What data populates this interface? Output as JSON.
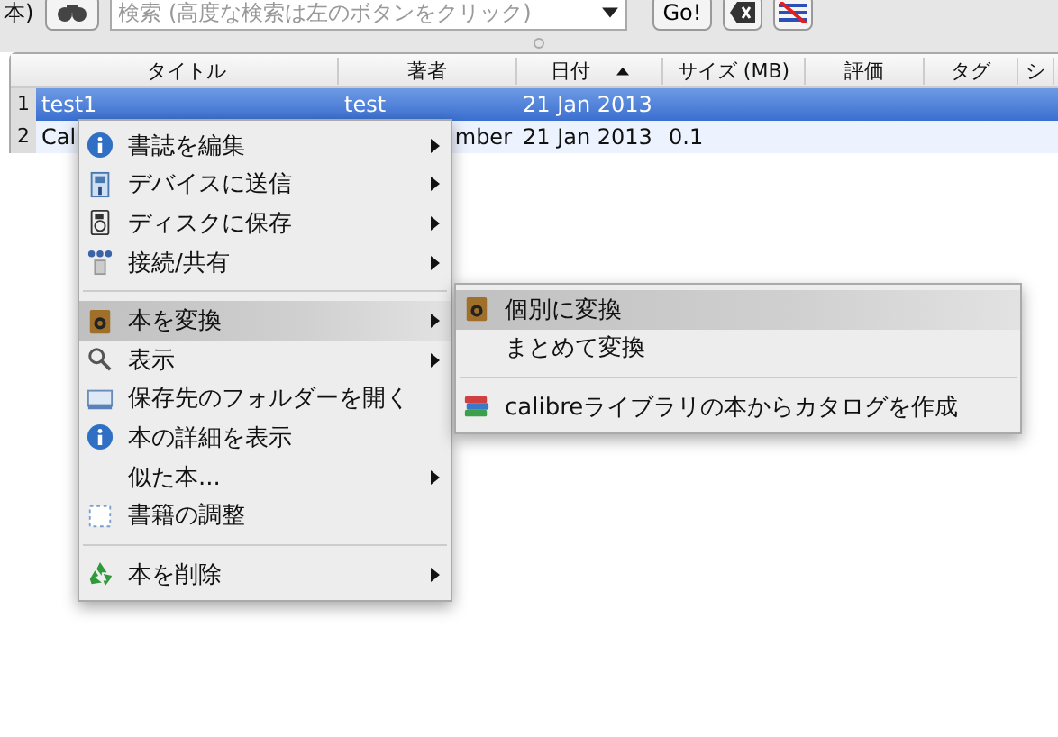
{
  "toolbar": {
    "left_label": "本)",
    "search": {
      "placeholder": "検索 (高度な検索は左のボタンをクリック)"
    },
    "go_button": "Go!"
  },
  "table": {
    "columns": [
      {
        "label": "タイトル",
        "sorted": false
      },
      {
        "label": "著者",
        "sorted": false
      },
      {
        "label": "日付",
        "sorted": true
      },
      {
        "label": "サイズ (MB)",
        "sorted": false
      },
      {
        "label": "評価",
        "sorted": false
      },
      {
        "label": "タグ",
        "sorted": false
      },
      {
        "label": "シ",
        "sorted": false
      }
    ],
    "rows": [
      {
        "number": "1",
        "selected": true,
        "cells": [
          "test1",
          "test",
          "21 Jan 2013",
          "",
          "",
          "",
          ""
        ]
      },
      {
        "number": "2",
        "selected": false,
        "cells": [
          "Cal",
          "mber",
          "21 Jan 2013",
          "0.1",
          "",
          "",
          ""
        ]
      }
    ]
  },
  "context_menu": {
    "items": [
      {
        "kind": "item",
        "label": "書誌を編集",
        "has_submenu": true,
        "selected": false
      },
      {
        "kind": "item",
        "label": "デバイスに送信",
        "has_submenu": true,
        "selected": false
      },
      {
        "kind": "item",
        "label": "ディスクに保存",
        "has_submenu": true,
        "selected": false
      },
      {
        "kind": "item",
        "label": "接続/共有",
        "has_submenu": true,
        "selected": false
      },
      {
        "kind": "separator"
      },
      {
        "kind": "item",
        "label": "本を変換",
        "has_submenu": true,
        "selected": true
      },
      {
        "kind": "item",
        "label": "表示",
        "has_submenu": true,
        "selected": false
      },
      {
        "kind": "item",
        "label": "保存先のフォルダーを開く",
        "has_submenu": false,
        "selected": false
      },
      {
        "kind": "item",
        "label": "本の詳細を表示",
        "has_submenu": false,
        "selected": false
      },
      {
        "kind": "item",
        "label": "似た本...",
        "has_submenu": true,
        "selected": false
      },
      {
        "kind": "item",
        "label": "書籍の調整",
        "has_submenu": false,
        "selected": false
      },
      {
        "kind": "separator"
      },
      {
        "kind": "item",
        "label": "本を削除",
        "has_submenu": true,
        "selected": false
      }
    ]
  },
  "submenu": {
    "items": [
      {
        "kind": "item",
        "label": "個別に変換",
        "selected": true
      },
      {
        "kind": "item",
        "label": "まとめて変換",
        "selected": false
      },
      {
        "kind": "separator"
      },
      {
        "kind": "item",
        "label": "calibreライブラリの本からカタログを作成",
        "selected": false
      }
    ]
  }
}
